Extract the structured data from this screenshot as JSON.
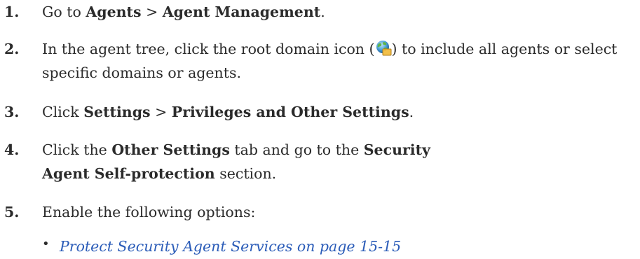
{
  "steps": [
    {
      "number": "1.",
      "parts": [
        "Go to ",
        "Agents",
        " > ",
        "Agent Management",
        "."
      ]
    },
    {
      "number": "2.",
      "parts": [
        "In the agent tree, click the root domain icon (",
        ") to include all agents or select specific domains or agents."
      ],
      "icon": "root-domain-globe-icon"
    },
    {
      "number": "3.",
      "parts": [
        "Click ",
        "Settings",
        " > ",
        "Privileges and Other Settings",
        "."
      ]
    },
    {
      "number": "4.",
      "parts": [
        "Click the ",
        "Other Settings",
        " tab and go to the ",
        "Security Agent Self-protection",
        " section."
      ]
    },
    {
      "number": "5.",
      "parts": [
        "Enable the following options:"
      ],
      "sub_items": [
        {
          "bullet": "•",
          "link_text": "Protect Security Agent Services on page 15-15"
        }
      ]
    }
  ],
  "colors": {
    "text": "#2b2b2b",
    "link": "#2b5cb8"
  }
}
